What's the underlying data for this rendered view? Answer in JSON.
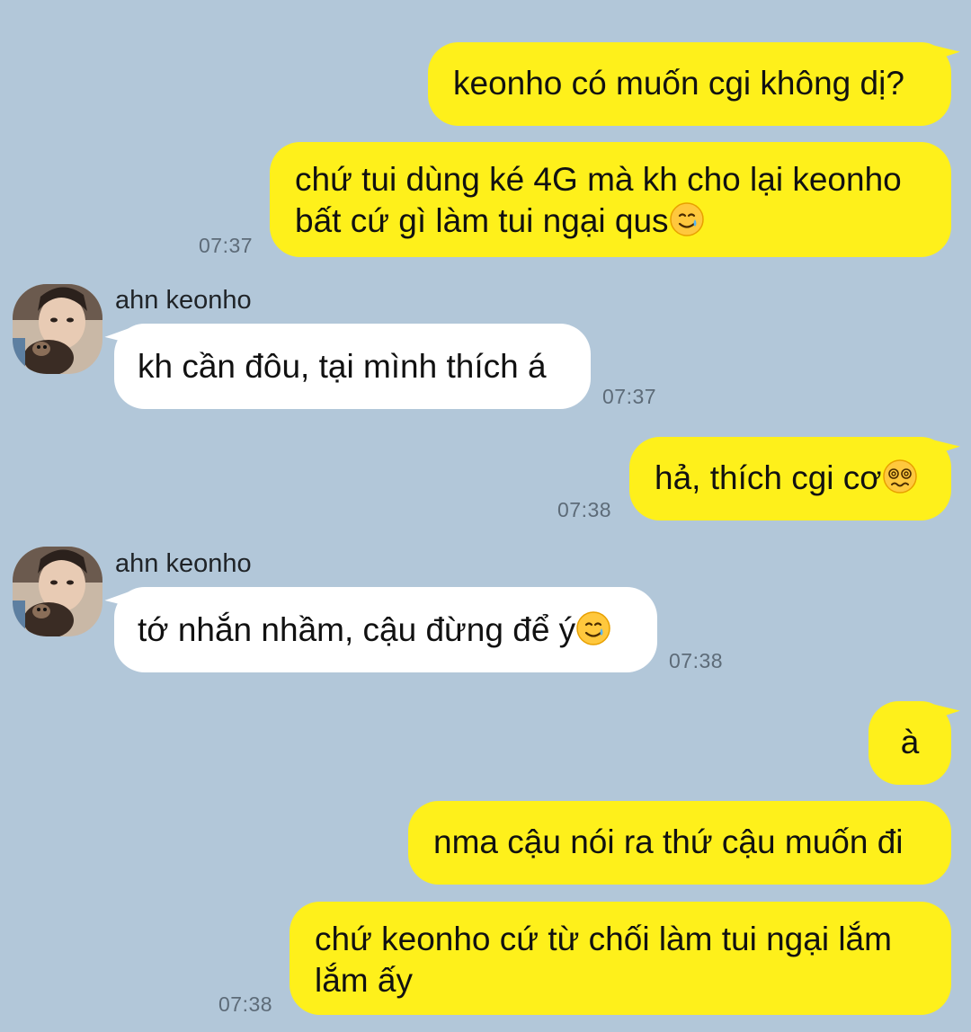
{
  "contact": {
    "name": "ahn keonho"
  },
  "messages": [
    {
      "id": "m1",
      "side": "out",
      "text": "keonho có muốn cgi không dị?",
      "time": ""
    },
    {
      "id": "m2",
      "side": "out",
      "lines": [
        "chứ tui dùng ké 4G mà kh cho lại keonho",
        "bất cứ gì làm tui ngại qus"
      ],
      "emoji": "smiling-face-with-tear",
      "time": "07:37"
    },
    {
      "id": "m3",
      "side": "in",
      "sender": "ahn keonho",
      "text": "kh cần đôu, tại mình thích á",
      "time": "07:37"
    },
    {
      "id": "m4",
      "side": "out",
      "text": "hả, thích cgi cơ",
      "emoji": "woozy-dizzy-face",
      "time": "07:38"
    },
    {
      "id": "m5",
      "side": "in",
      "sender": "ahn keonho",
      "text": "tớ nhắn nhầm, cậu đừng để ý",
      "emoji": "smiling-face-with-tear",
      "time": "07:38"
    },
    {
      "id": "m6",
      "side": "out",
      "text": "à",
      "time": ""
    },
    {
      "id": "m7",
      "side": "out",
      "text": "nma cậu nói ra thứ cậu muốn đi",
      "time": ""
    },
    {
      "id": "m8",
      "side": "out",
      "lines": [
        "chứ keonho cứ từ chối làm tui ngại lắm",
        "lắm ấy"
      ],
      "time": "07:38"
    }
  ],
  "colors": {
    "background": "#b2c7d9",
    "outgoing_bubble": "#fef01b",
    "incoming_bubble": "#ffffff",
    "timestamp": "#5d6b78"
  }
}
